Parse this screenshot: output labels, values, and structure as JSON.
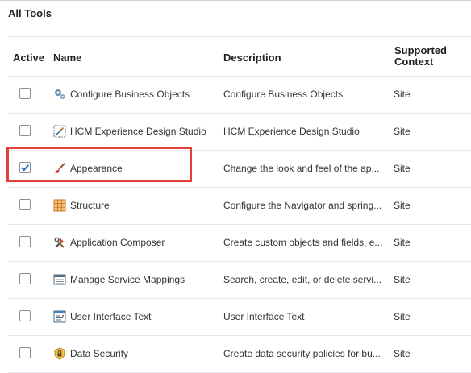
{
  "section_title": "All Tools",
  "columns": {
    "active": "Active",
    "name": "Name",
    "description": "Description",
    "context_line1": "Supported",
    "context_line2": "Context"
  },
  "rows": [
    {
      "checked": false,
      "icon": "gears-icon",
      "name": "Configure Business Objects",
      "description": "Configure Business Objects",
      "context": "Site"
    },
    {
      "checked": false,
      "icon": "design-studio-icon",
      "name": "HCM Experience Design Studio",
      "description": "HCM Experience Design Studio",
      "context": "Site"
    },
    {
      "checked": true,
      "icon": "paintbrush-icon",
      "name": "Appearance",
      "description": "Change the look and feel of the ap...",
      "context": "Site"
    },
    {
      "checked": false,
      "icon": "structure-grid-icon",
      "name": "Structure",
      "description": "Configure the Navigator and spring...",
      "context": "Site"
    },
    {
      "checked": false,
      "icon": "tools-icon",
      "name": "Application Composer",
      "description": "Create custom objects and fields, e...",
      "context": "Site"
    },
    {
      "checked": false,
      "icon": "service-mappings-icon",
      "name": "Manage Service Mappings",
      "description": "Search, create, edit, or delete servi...",
      "context": "Site"
    },
    {
      "checked": false,
      "icon": "ui-text-icon",
      "name": "User Interface Text",
      "description": "User Interface Text",
      "context": "Site"
    },
    {
      "checked": false,
      "icon": "lock-shield-icon",
      "name": "Data Security",
      "description": "Create data security policies for bu...",
      "context": "Site"
    }
  ],
  "colors": {
    "highlight": "#e0413b",
    "check": "#1a6fc4"
  }
}
